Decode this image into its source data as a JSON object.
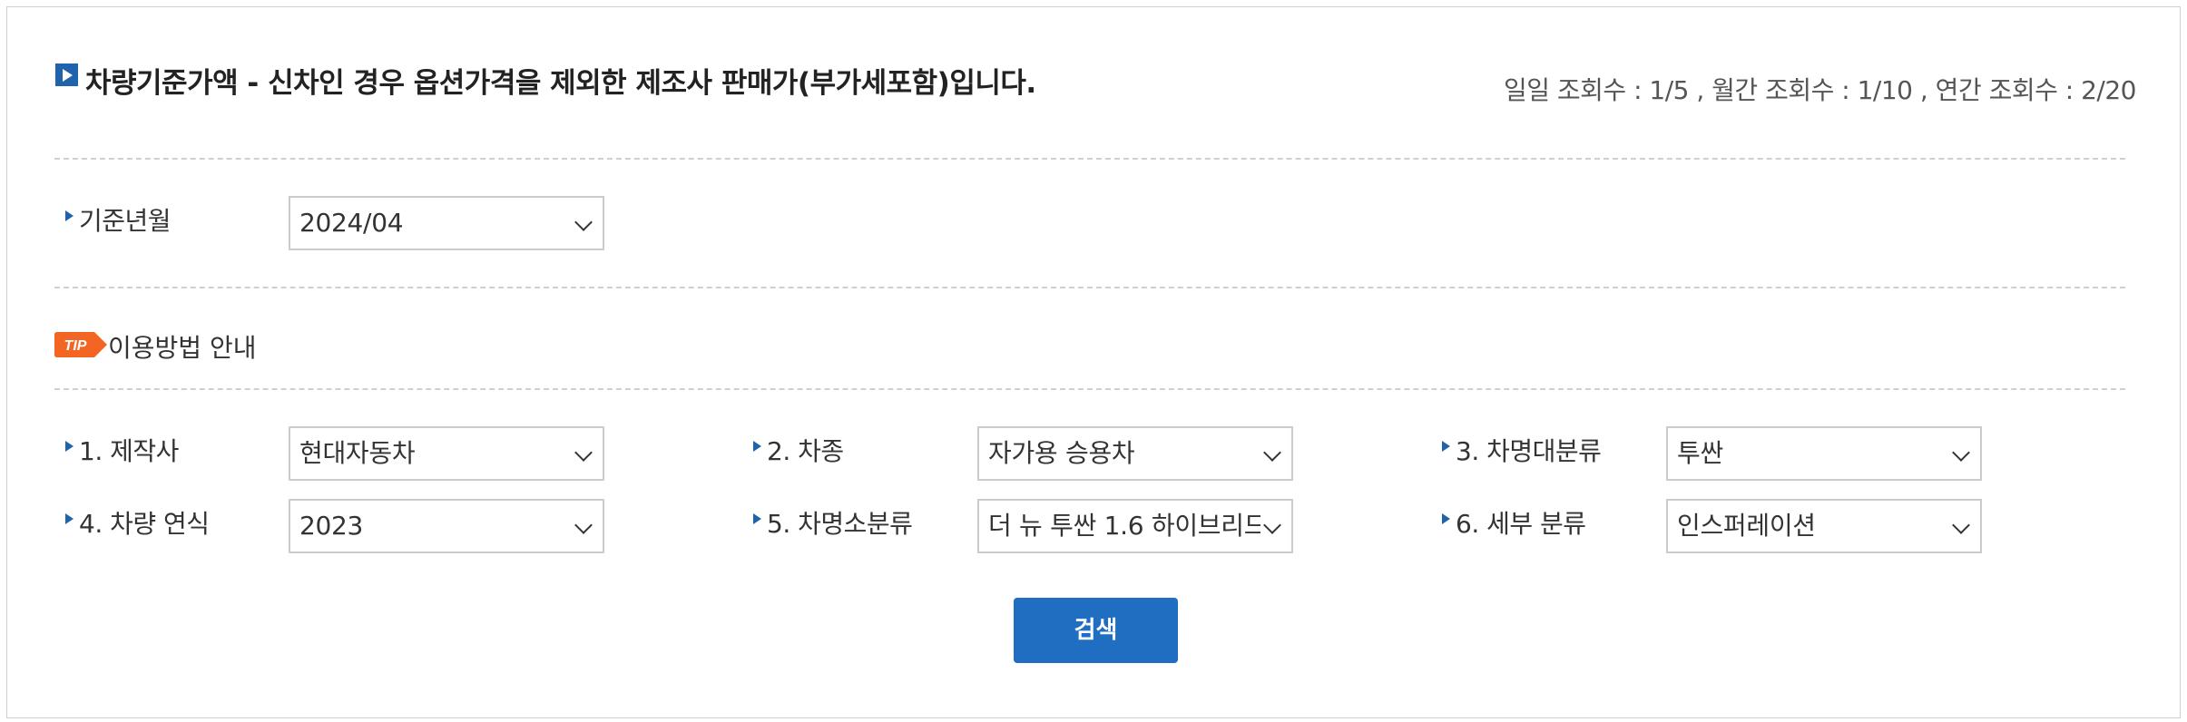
{
  "header": {
    "title": "차량기준가액 - 신차인 경우 옵션가격을 제외한 제조사 판매가(부가세포함)입니다.",
    "view_counts": "일일 조회수 : 1/5 , 월간 조회수 : 1/10 , 연간 조회수 : 2/20"
  },
  "base_date": {
    "label": "기준년월",
    "value": "2024/04"
  },
  "tip": {
    "badge": "TIP",
    "text": "이용방법 안내"
  },
  "filters": [
    {
      "label": "1. 제작사",
      "value": "현대자동차"
    },
    {
      "label": "2. 차종",
      "value": "자가용 승용차"
    },
    {
      "label": "3. 차명대분류",
      "value": "투싼"
    },
    {
      "label": "4. 차량 연식",
      "value": "2023"
    },
    {
      "label": "5. 차명소분류",
      "value": "더 뉴 투싼 1.6 하이브리드"
    },
    {
      "label": "6. 세부 분류",
      "value": "인스퍼레이션"
    }
  ],
  "search_button": "검색",
  "colors": {
    "accent": "#1f63ad",
    "button": "#1f6ec1",
    "tip": "#f26522",
    "border": "#cccccc"
  }
}
